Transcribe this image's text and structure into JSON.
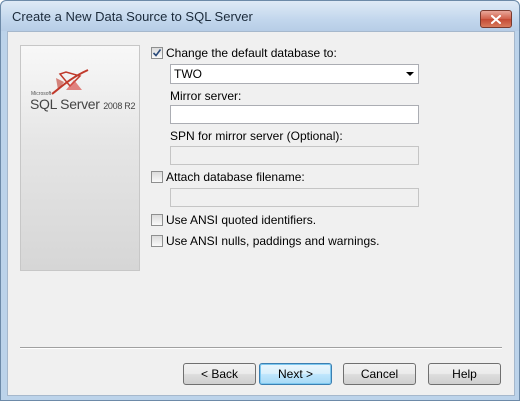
{
  "window": {
    "title": "Create a New Data Source to SQL Server"
  },
  "banner": {
    "ms_text": "Microsoft",
    "product": "SQL Server",
    "version": "2008 R2"
  },
  "options": {
    "change_db": {
      "label": "Change the default database to:",
      "checked": true,
      "value": "TWO"
    },
    "mirror": {
      "label": "Mirror server:",
      "value": ""
    },
    "spn": {
      "label": "SPN for mirror server (Optional):",
      "value": ""
    },
    "attach": {
      "label": "Attach database filename:",
      "checked": false,
      "value": ""
    },
    "ansi_quoted": {
      "label": "Use ANSI quoted identifiers.",
      "checked": false
    },
    "ansi_nulls": {
      "label": "Use ANSI nulls, paddings and warnings.",
      "checked": false
    }
  },
  "buttons": {
    "back": "< Back",
    "next": "Next >",
    "cancel": "Cancel",
    "help": "Help"
  },
  "colors": {
    "titlebar": "#c3d7ed",
    "client_bg": "#f0f0f0",
    "close": "#c44a34",
    "default_button": "#3c7fb1"
  },
  "icons": {
    "close": "close-x-icon",
    "check": "checkmark-icon",
    "logo": "sql-server-logo"
  }
}
